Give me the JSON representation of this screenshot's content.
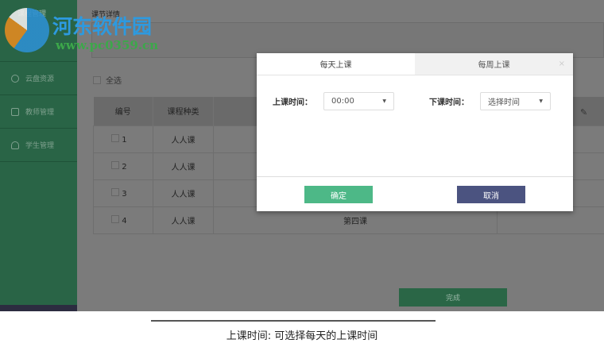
{
  "sidebar": {
    "header": "课程管理",
    "items": [
      {
        "label": "云盘资源"
      },
      {
        "label": "教师管理"
      },
      {
        "label": "学生管理"
      }
    ]
  },
  "main": {
    "title": "课节详情",
    "select_all": "全选",
    "done": "完成",
    "columns": [
      "编号",
      "课程种类",
      "",
      ""
    ],
    "rows": [
      {
        "no": "1",
        "type": "人人课",
        "name": ""
      },
      {
        "no": "2",
        "type": "人人课",
        "name": ""
      },
      {
        "no": "3",
        "type": "人人课",
        "name": ""
      },
      {
        "no": "4",
        "type": "人人课",
        "name": "第四课"
      }
    ]
  },
  "modal": {
    "tabs": [
      {
        "label": "每天上课",
        "active": true
      },
      {
        "label": "每周上课",
        "active": false
      }
    ],
    "close": "×",
    "start_label": "上课时间：",
    "start_value": "00:00",
    "end_label": "下课时间：",
    "end_placeholder": "选择时间",
    "ok": "确定",
    "cancel": "取消"
  },
  "watermark": {
    "name": "河东软件园",
    "url": "www.pc0359.cn"
  },
  "caption": "上课时间: 可选择每天的上课时间"
}
